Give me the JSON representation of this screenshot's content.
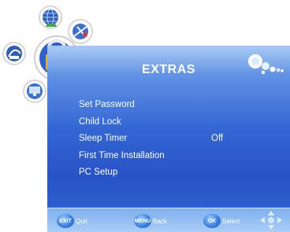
{
  "menu_title": "EXTRAS",
  "items": [
    {
      "label": "Set Password",
      "value": ""
    },
    {
      "label": "Child Lock",
      "value": ""
    },
    {
      "label": "Sleep Timer",
      "value": "Off"
    },
    {
      "label": "First Time Installation",
      "value": ""
    },
    {
      "label": "PC Setup",
      "value": ""
    }
  ],
  "footer": {
    "exit_key": "EXIT",
    "exit_label": "Quit",
    "menu_key": "MENU",
    "menu_label": "Back",
    "ok_key": "OK",
    "ok_label": "Select"
  },
  "colors": {
    "panel": "#3366d4",
    "accent_orange": "#f5b21e",
    "icon_green": "#3fa34a"
  },
  "icons": [
    "globe-icon",
    "satellite-icon",
    "lock-icon",
    "gear-icon",
    "monitor-icon",
    "nav-arrows-icon",
    "decorative-bubbles-icon"
  ]
}
